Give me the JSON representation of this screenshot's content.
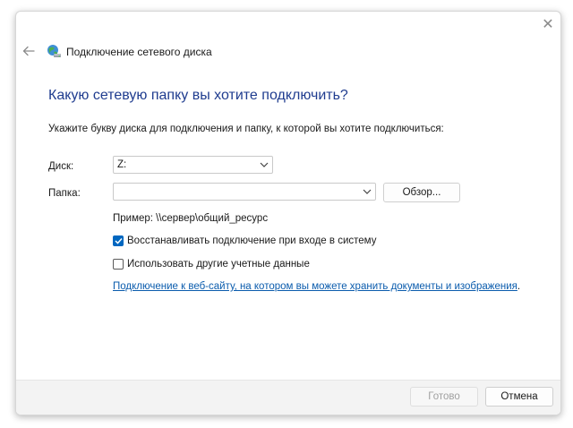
{
  "window": {
    "title": "Подключение сетевого диска",
    "close_glyph": "✕"
  },
  "heading": "Какую сетевую папку вы хотите подключить?",
  "instruction": "Укажите букву диска для подключения и папку, к которой вы хотите подключиться:",
  "drive": {
    "label": "Диск:",
    "value": "Z:"
  },
  "folder": {
    "label": "Папка:",
    "value": "",
    "browse_label": "Обзор..."
  },
  "example": "Пример: \\\\сервер\\общий_ресурс",
  "reconnect": {
    "label": "Восстанавливать подключение при входе в систему",
    "checked": true
  },
  "other_creds": {
    "label": "Использовать другие учетные данные",
    "checked": false
  },
  "link": {
    "text": "Подключение к веб-сайту, на котором вы можете хранить документы и изображения",
    "suffix": "."
  },
  "footer": {
    "ok_label": "Готово",
    "cancel_label": "Отмена"
  },
  "colors": {
    "heading": "#1f3c8f",
    "accent": "#0067c0",
    "link": "#0b5cad"
  },
  "icons": [
    "close-icon",
    "back-arrow-icon",
    "network-drive-icon",
    "chevron-down-icon",
    "checkmark-icon"
  ]
}
